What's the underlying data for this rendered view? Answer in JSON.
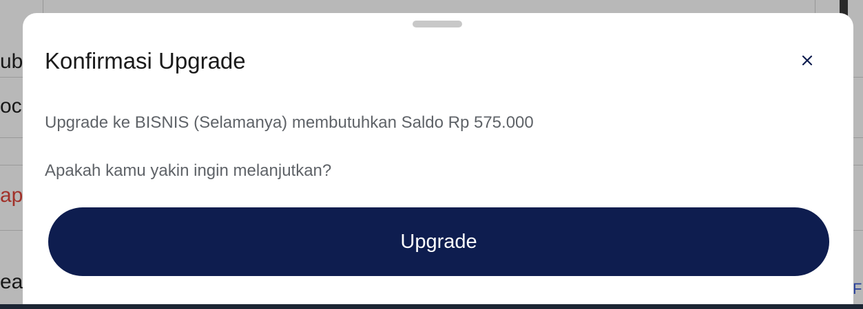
{
  "background": {
    "fragments": [
      "ub",
      "oc",
      "ap",
      "ea"
    ],
    "right_fragment": "F"
  },
  "dialog": {
    "title": "Konfirmasi Upgrade",
    "close_icon": "close-icon",
    "message": "Upgrade ke BISNIS (Selamanya) membutuhkan Saldo Rp 575.000",
    "question": "Apakah kamu yakin ingin melanjutkan?",
    "primary_button": "Upgrade"
  },
  "colors": {
    "primary": "#0e1d4f",
    "text_secondary": "#5f6368",
    "accent_red": "#e0443a"
  }
}
